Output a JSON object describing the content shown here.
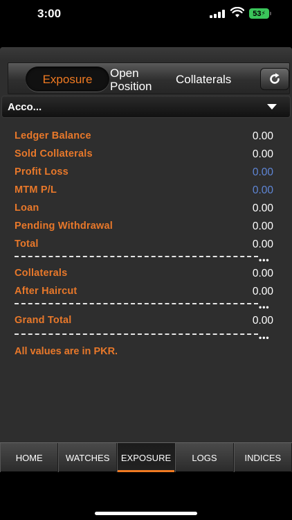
{
  "status_bar": {
    "time": "3:00",
    "battery": "53"
  },
  "tabs": {
    "exposure": "Exposure",
    "open_position_line1": "Open",
    "open_position_line2": "Position",
    "collaterals": "Collaterals"
  },
  "account_selector": {
    "value": "Acco..."
  },
  "rows": [
    {
      "label": "Ledger Balance",
      "value": "0.00"
    },
    {
      "label": "Sold Collaterals",
      "value": "0.00"
    },
    {
      "label": "Profit Loss",
      "value": "0.00"
    },
    {
      "label": "MTM P/L",
      "value": "0.00"
    },
    {
      "label": "Loan",
      "value": "0.00"
    },
    {
      "label": "Pending Withdrawal",
      "value": "0.00"
    },
    {
      "label": "Total",
      "value": "0.00"
    },
    {
      "label": "Collaterals",
      "value": "0.00"
    },
    {
      "label": "After Haircut",
      "value": "0.00"
    },
    {
      "label": "Grand Total",
      "value": "0.00"
    }
  ],
  "separator_tail": "•••",
  "note": "All values are in PKR.",
  "bottom_nav": [
    "HOME",
    "WATCHES",
    "EXPOSURE",
    "LOGS",
    "INDICES"
  ],
  "colors": {
    "accent": "#f07a22",
    "label": "#e8782a",
    "link_value": "#5f86d6",
    "background": "#2e2e2e"
  }
}
